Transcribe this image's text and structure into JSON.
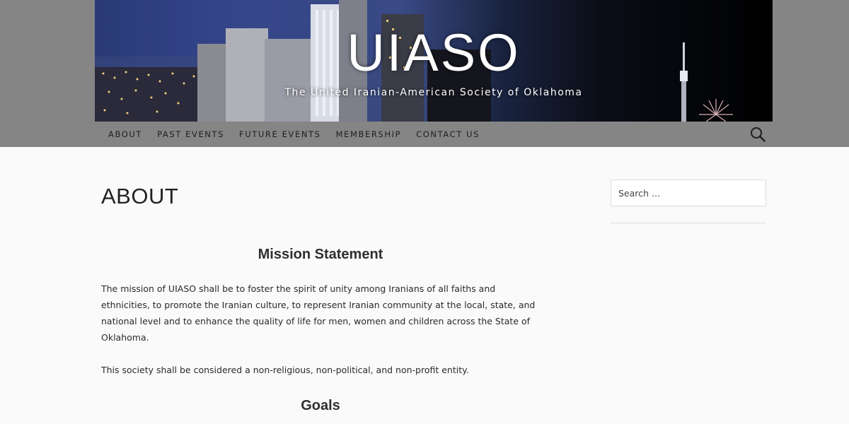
{
  "site": {
    "title": "UIASO",
    "tagline": "The United Iranian-American Society of Oklahoma"
  },
  "nav": {
    "items": [
      {
        "label": "ABOUT"
      },
      {
        "label": "PAST EVENTS"
      },
      {
        "label": "FUTURE EVENTS"
      },
      {
        "label": "MEMBERSHIP"
      },
      {
        "label": "CONTACT US"
      }
    ],
    "search_icon": "search-icon"
  },
  "page": {
    "title": "ABOUT",
    "mission_heading": "Mission Statement",
    "mission_paragraph": "The mission of UIASO shall be to foster the spirit of unity among Iranians of all faiths and ethnicities, to promote the Iranian culture, to represent Iranian community at the local, state, and national level and to enhance the quality of life for men, women and children across the State of Oklahoma.",
    "society_paragraph": "This society shall be considered a non-religious, non-political, and non-profit entity.",
    "goals_heading": "Goals"
  },
  "sidebar": {
    "search_placeholder": "Search …"
  },
  "colors": {
    "nav_band": "#858585",
    "page_bg": "#fafafa",
    "text": "#2a2a2a"
  }
}
